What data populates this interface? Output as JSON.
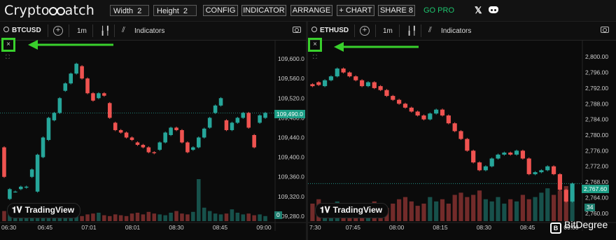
{
  "app": {
    "logo_part1": "Crypto",
    "logo_part2": "atch"
  },
  "toolbar": {
    "width_label": "Width",
    "width_value": "2",
    "height_label": "Height",
    "height_value": "2",
    "config": "CONFIG",
    "indicator": "INDICATOR",
    "arrange": "ARRANGE",
    "add_chart": "+ CHART",
    "share": "SHARE 8",
    "gopro": "GO PRO",
    "x_glyph": "𝕏"
  },
  "colors": {
    "up": "#26a69a",
    "down": "#ef5350",
    "highlight": "#39d02c",
    "go_pro": "#1ec46e"
  },
  "icons": [
    "search-icon",
    "plus-icon",
    "candles-icon",
    "indicators-icon",
    "camera-icon",
    "close-icon",
    "fullscreen-icon",
    "x-icon",
    "discord-icon"
  ],
  "left_chart": {
    "symbol": "BTCUSD",
    "timeframe": "1m",
    "indicators_label": "Indicators",
    "close_glyph": "×",
    "fs_glyph": "⛶",
    "price_tag": "109,490.0",
    "volume_tag": "0",
    "watermark": "TradingView",
    "y_ticks": [
      "109,600.0",
      "109,560.0",
      "109,520.0",
      "109,480.0",
      "109,440.0",
      "109,400.0",
      "109,360.0",
      "109,320.0",
      "109,280.0"
    ],
    "x_ticks": [
      "06:30",
      "06:45",
      "07:01",
      "08:01",
      "08:30",
      "08:45",
      "09:00"
    ]
  },
  "right_chart": {
    "symbol": "ETHUSD",
    "timeframe": "1m",
    "indicators_label": "Indicators",
    "close_glyph": "×",
    "fs_glyph": "⛶",
    "price_tag": "2,767.60",
    "volume_tag": "34",
    "watermark": "TradingView",
    "y_ticks": [
      "2,800.00",
      "2,796.00",
      "2,792.00",
      "2,788.00",
      "2,784.00",
      "2,780.00",
      "2,776.00",
      "2,772.00",
      "2,768.00",
      "2,764.00",
      "2,760.00"
    ],
    "x_ticks": [
      "7:30",
      "07:45",
      "08:00",
      "08:15",
      "08:30",
      "08:45",
      "09:00"
    ]
  },
  "brand": {
    "name": "BitDegree",
    "icon_glyph": "B"
  },
  "chart_data": [
    {
      "type": "candlestick",
      "title": "BTCUSD 1m",
      "ylim": [
        109270,
        109620
      ],
      "x": [
        "06:30",
        "06:33",
        "06:36",
        "06:39",
        "06:42",
        "06:45",
        "06:48",
        "06:51",
        "06:54",
        "06:57",
        "07:00",
        "07:03",
        "07:06",
        "07:09",
        "07:12",
        "07:15",
        "07:18",
        "07:21",
        "07:24",
        "07:27",
        "07:30",
        "07:33",
        "07:36",
        "07:39",
        "07:42",
        "07:45",
        "07:48",
        "07:51",
        "07:54",
        "07:57",
        "08:00",
        "08:03",
        "08:06",
        "08:09",
        "08:12",
        "08:15",
        "08:18",
        "08:21",
        "08:24",
        "08:27",
        "08:30",
        "08:33",
        "08:36",
        "08:39",
        "08:42",
        "08:45",
        "08:48",
        "08:51"
      ],
      "open": [
        109420,
        109315,
        109330,
        109335,
        109338,
        109360,
        109330,
        109400,
        109435,
        109475,
        109490,
        109535,
        109550,
        109570,
        109585,
        109560,
        109530,
        109520,
        109530,
        109510,
        109470,
        109455,
        109450,
        109440,
        109430,
        109425,
        109420,
        109410,
        109415,
        109430,
        109445,
        109460,
        109455,
        109430,
        109415,
        109420,
        109440,
        109460,
        109490,
        109505,
        109475,
        109455,
        109470,
        109480,
        109490,
        109445,
        109470,
        109480
      ],
      "close": [
        109360,
        109335,
        109330,
        109340,
        109340,
        109375,
        109405,
        109440,
        109480,
        109490,
        109520,
        109550,
        109570,
        109590,
        109560,
        109530,
        109515,
        109530,
        109525,
        109480,
        109455,
        109450,
        109440,
        109435,
        109425,
        109420,
        109410,
        109408,
        109430,
        109450,
        109460,
        109455,
        109430,
        109410,
        109420,
        109440,
        109458,
        109480,
        109505,
        109520,
        109455,
        109470,
        109480,
        109490,
        109460,
        109420,
        109485,
        109490
      ],
      "volume": [
        12,
        18,
        10,
        10,
        8,
        14,
        9,
        11,
        10,
        8,
        15,
        12,
        9,
        7,
        6,
        8,
        9,
        10,
        7,
        6,
        8,
        7,
        6,
        9,
        10,
        8,
        11,
        9,
        8,
        7,
        10,
        12,
        9,
        8,
        11,
        50,
        16,
        12,
        9,
        8,
        9,
        14,
        10,
        8,
        9,
        7,
        8,
        6
      ]
    },
    {
      "type": "candlestick",
      "title": "ETHUSD 1m",
      "ylim": [
        2758,
        2802
      ],
      "x": [
        "07:30",
        "07:32",
        "07:34",
        "07:36",
        "07:38",
        "07:40",
        "07:42",
        "07:44",
        "07:46",
        "07:48",
        "07:50",
        "07:52",
        "07:54",
        "07:56",
        "07:58",
        "08:00",
        "08:02",
        "08:04",
        "08:06",
        "08:08",
        "08:10",
        "08:12",
        "08:14",
        "08:16",
        "08:18",
        "08:20",
        "08:22",
        "08:24",
        "08:26",
        "08:28",
        "08:30",
        "08:32",
        "08:34",
        "08:36",
        "08:38",
        "08:40",
        "08:42",
        "08:44",
        "08:46",
        "08:48",
        "08:50",
        "08:52",
        "08:54"
      ],
      "open": [
        2793.0,
        2793.5,
        2792.5,
        2794.0,
        2795.0,
        2797.0,
        2796.0,
        2795.0,
        2794.0,
        2792.5,
        2793.5,
        2792.5,
        2791.5,
        2790.0,
        2789.0,
        2788.0,
        2787.0,
        2786.0,
        2785.0,
        2784.0,
        2785.5,
        2786.5,
        2785.0,
        2783.0,
        2781.0,
        2779.0,
        2776.0,
        2773.0,
        2771.0,
        2772.0,
        2774.0,
        2775.0,
        2775.5,
        2775.0,
        2776.0,
        2774.0,
        2770.0,
        2770.5,
        2771.0,
        2772.0,
        2770.0,
        2766.0,
        2763.0
      ],
      "close": [
        2792.5,
        2792.8,
        2794.0,
        2795.0,
        2797.0,
        2796.0,
        2795.0,
        2794.0,
        2792.5,
        2793.5,
        2792.0,
        2791.5,
        2790.0,
        2789.0,
        2788.0,
        2787.0,
        2786.0,
        2785.0,
        2784.0,
        2785.5,
        2786.5,
        2785.0,
        2783.0,
        2781.0,
        2779.0,
        2776.0,
        2773.0,
        2771.0,
        2772.0,
        2774.0,
        2775.0,
        2775.5,
        2775.0,
        2776.0,
        2774.0,
        2770.0,
        2770.5,
        2771.0,
        2772.0,
        2770.0,
        2766.0,
        2763.0,
        2767.6
      ],
      "volume": [
        16,
        20,
        12,
        14,
        18,
        12,
        16,
        14,
        10,
        12,
        18,
        14,
        12,
        16,
        20,
        22,
        18,
        14,
        16,
        22,
        18,
        20,
        16,
        24,
        26,
        22,
        24,
        28,
        20,
        18,
        22,
        16,
        20,
        18,
        24,
        20,
        22,
        26,
        30,
        24,
        28,
        32,
        26
      ]
    }
  ]
}
